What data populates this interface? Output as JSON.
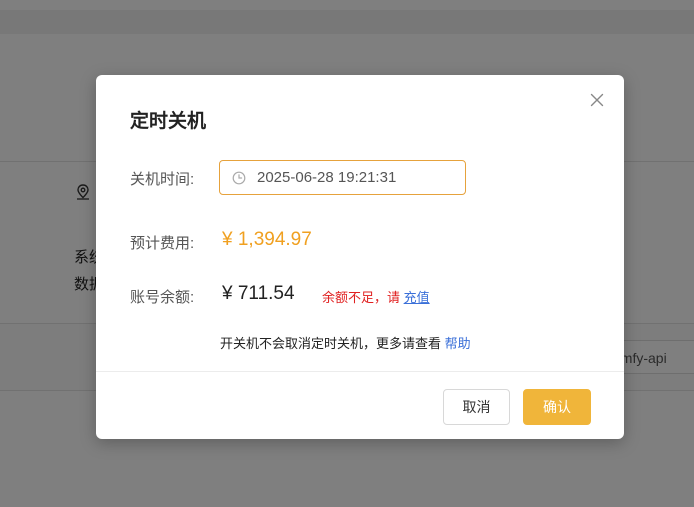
{
  "background": {
    "text_line1": "系统",
    "text_line2": "数据",
    "tag_text": "omfy-api"
  },
  "dialog": {
    "title": "定时关机",
    "shutdown_time_label": "关机时间:",
    "shutdown_time_value": "2025-06-28 19:21:31",
    "estimated_cost_label": "预计费用:",
    "estimated_cost_value": "¥ 1,394.97",
    "balance_label": "账号余额:",
    "balance_value": "¥ 711.54",
    "insufficient_text": "余额不足，请 ",
    "recharge_link": "充值",
    "note_text": "开关机不会取消定时关机，更多请查看 ",
    "help_link": "帮助",
    "cancel_button": "取消",
    "confirm_button": "确认"
  },
  "colors": {
    "accent": "#f0b53a",
    "price": "#f0a020",
    "warning": "#e02020",
    "link": "#3a6fd8"
  },
  "icons": {
    "close": "close-icon",
    "clock": "clock-icon",
    "location": "location-pin-icon"
  }
}
